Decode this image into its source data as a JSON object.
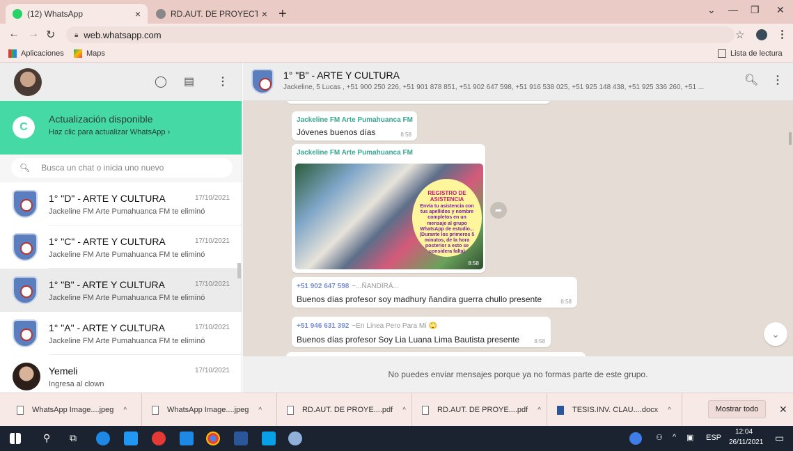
{
  "browser": {
    "tabs": [
      {
        "label": "(12) WhatsApp",
        "close": "×"
      },
      {
        "label": "RD.AUT. DE PROYECTO JUDITH C",
        "close": "×"
      }
    ],
    "new_tab": "+",
    "url": "web.whatsapp.com",
    "bookmarks": [
      {
        "label": "Aplicaciones"
      },
      {
        "label": "Maps"
      }
    ],
    "reading_list": "Lista de lectura"
  },
  "sidebar": {
    "update": {
      "title": "Actualización disponible",
      "subtitle": "Haz clic para actualizar WhatsApp ›"
    },
    "search_placeholder": "Busca un chat o inicia uno nuevo",
    "chats": [
      {
        "name": "1° \"D\" - ARTE Y CULTURA",
        "date": "17/10/2021",
        "preview": "Jackeline FM Arte Pumahuanca FM te eliminó"
      },
      {
        "name": "1° \"C\" - ARTE Y CULTURA",
        "date": "17/10/2021",
        "preview": "Jackeline FM Arte Pumahuanca FM te eliminó"
      },
      {
        "name": "1° \"B\" - ARTE Y CULTURA",
        "date": "17/10/2021",
        "preview": "Jackeline FM Arte Pumahuanca FM te eliminó"
      },
      {
        "name": "1° \"A\" - ARTE Y CULTURA",
        "date": "17/10/2021",
        "preview": "Jackeline FM Arte Pumahuanca FM te eliminó"
      },
      {
        "name": "Yemeli",
        "date": "17/10/2021",
        "preview": "Ingresa al clown"
      }
    ]
  },
  "conversation": {
    "title": "1° \"B\" - ARTE Y CULTURA",
    "members": "Jackeline, 5 Lucas , +51 900 250 226, +51 901 878 851, +51 902 647 598, +51 916 538 025, +51 925 148 438, +51 925 336 260, +51 ...",
    "messages": [
      {
        "sender": "Jackeline FM Arte Pumahuanca FM",
        "text": "Jóvenes buenos días",
        "time": "8:58"
      },
      {
        "sender": "Jackeline FM Arte Pumahuanca FM",
        "image": {
          "heading": "REGISTRO DE ASISTENCIA",
          "body": "Envía tu asistencia con tus apellidos y nombre completos en un mensaje al grupo WhatsApp de estudio... (Durante los primeros 5 minutos, de la hora posterior a esto se considera falta)"
        },
        "time": "8:58"
      },
      {
        "sender": "+51 902 647 598",
        "alias": "~...ÑANDÏRÄ...",
        "text": "Buenos días profesor soy madhury ñandira guerra chullo presente",
        "time": "8:58"
      },
      {
        "sender": "+51 946 631 392",
        "alias": "~En Línea Pero Para Mí 🙄",
        "text": "Buenos días profesor Soy Lia Luana Lima Bautista presente",
        "time": "8:58"
      }
    ],
    "footer": "No puedes enviar mensajes porque ya no formas parte de este grupo."
  },
  "downloads": {
    "items": [
      {
        "label": "WhatsApp Image....jpeg"
      },
      {
        "label": "WhatsApp Image....jpeg"
      },
      {
        "label": "RD.AUT. DE PROYE....pdf"
      },
      {
        "label": "RD.AUT. DE PROYE....pdf"
      },
      {
        "label": "TESIS.INV. CLAU....docx"
      }
    ],
    "show_all": "Mostrar todo"
  },
  "taskbar": {
    "lang": "ESP",
    "time": "12:04",
    "date": "26/11/2021"
  },
  "colors": {
    "update_banner": "#44d9a5",
    "sender_green": "#35a78f",
    "chat_bg": "#e5ddd5"
  }
}
